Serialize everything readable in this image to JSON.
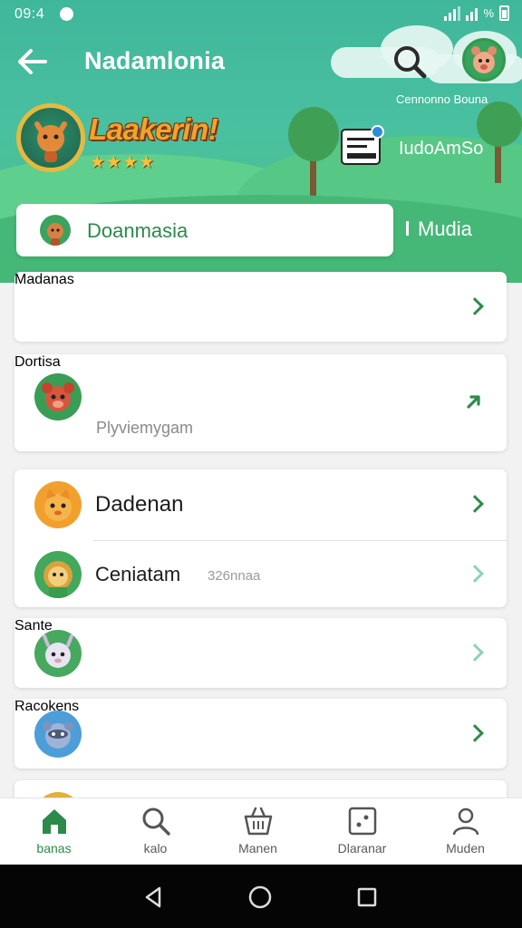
{
  "status_bar": {
    "time": "09:4",
    "battery_pct": "%"
  },
  "header": {
    "title": "Nadamlonia",
    "profile_name": "Cennonno Bouna",
    "logo_text": "Laakerin!",
    "rating_stars": 4,
    "stars_text": "★★★★",
    "card_label": "IudoAmSo"
  },
  "tabs": {
    "active_label": "Doanmasia",
    "other_label": "Mudia"
  },
  "list": {
    "row1_title": "Madanas",
    "row2_title": "Dortisa",
    "row2_subtitle": "Plyviemygam",
    "row3_title": "Dadenan",
    "row4_title": "Ceniatam",
    "row4_meta": "326nnaa",
    "row5_title": "Sante",
    "row6_title": "Racokens"
  },
  "bottom_nav": [
    {
      "label": "banas",
      "icon": "home-icon",
      "active": true
    },
    {
      "label": "kalo",
      "icon": "search-icon",
      "active": false
    },
    {
      "label": "Manen",
      "icon": "basket-icon",
      "active": false
    },
    {
      "label": "Dlaranar",
      "icon": "dice-icon",
      "active": false
    },
    {
      "label": "Muden",
      "icon": "person-icon",
      "active": false
    }
  ],
  "colors": {
    "accent": "#2c8a4a",
    "header_top": "#3fb79a",
    "header_bottom": "#4cbd84"
  }
}
